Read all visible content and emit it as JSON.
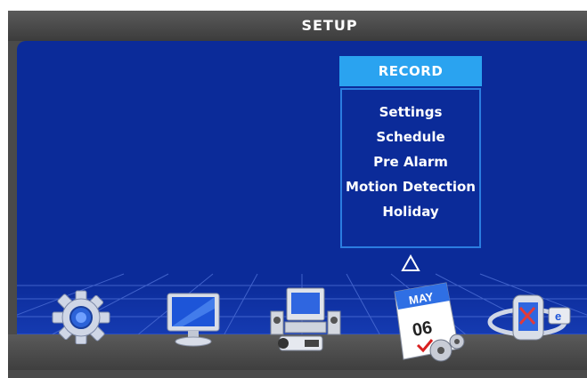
{
  "window": {
    "title": "SETUP"
  },
  "record_menu": {
    "header": "RECORD",
    "items": [
      "Settings",
      "Schedule",
      "Pre Alarm",
      "Motion Detection",
      "Holiday"
    ]
  },
  "icons": [
    {
      "name": "gear-icon"
    },
    {
      "name": "monitor-icon"
    },
    {
      "name": "computer-camera-icon"
    },
    {
      "name": "calendar-icon",
      "month": "MAY",
      "day": "06",
      "selected": true
    },
    {
      "name": "network-icon",
      "badge": "e"
    }
  ],
  "colors": {
    "panel_bg": "#0b2b99",
    "menu_header_bg": "#2aa3f0",
    "menu_border": "#2b7de0",
    "frame": "#4a4a4a"
  }
}
